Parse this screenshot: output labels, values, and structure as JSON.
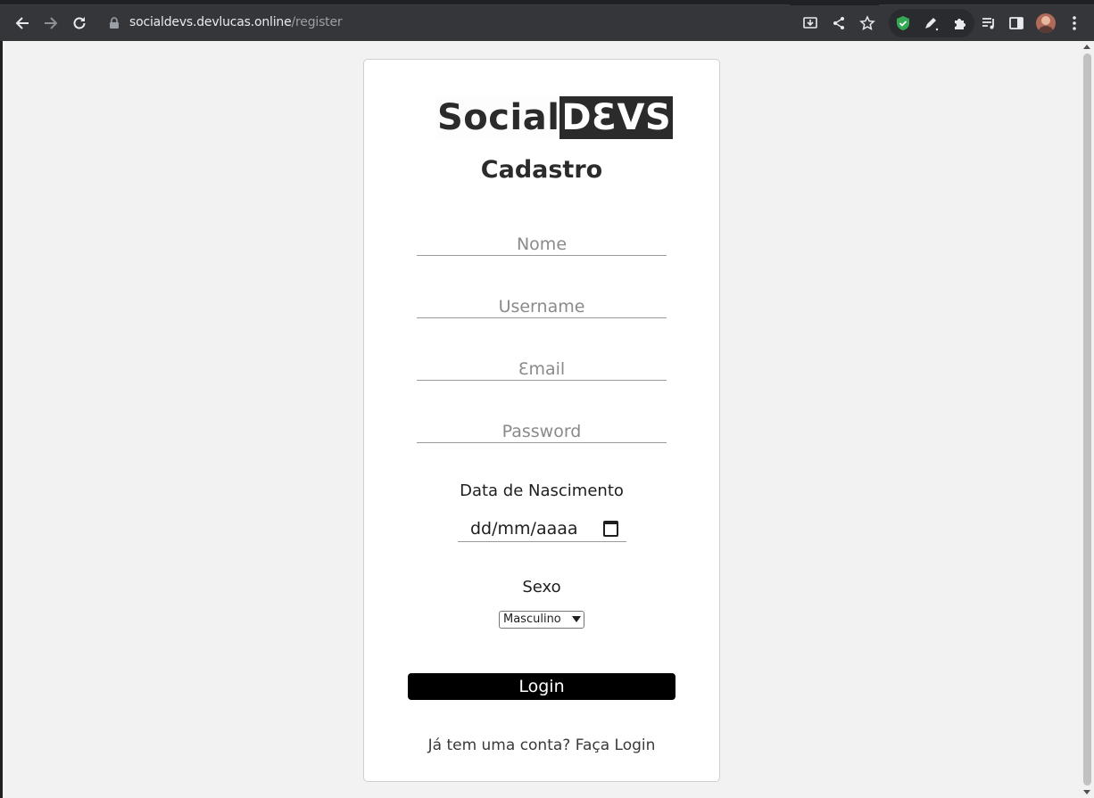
{
  "browser": {
    "url_host": "socialdevs.devlucas.online",
    "url_path": "/register"
  },
  "logo": {
    "part1": "Social",
    "part2": "DƐVS"
  },
  "form": {
    "title": "Cadastro",
    "name_placeholder": "Nome",
    "username_placeholder": "Username",
    "email_placeholder": "Ɛmail",
    "password_placeholder": "Password",
    "birth_label": "Data de Nascimento",
    "birth_value": "dd/mm/aaaa",
    "sex_label": "Sexo",
    "sex_selected": "Masculino",
    "submit_label": "Login",
    "login_link": "Já tem uma conta? Faça Login"
  },
  "icons": {
    "back": "back-arrow-icon",
    "forward": "forward-arrow-icon",
    "reload": "reload-icon",
    "lock": "lock-icon",
    "install": "install-icon",
    "share": "share-icon",
    "bookmark": "star-icon",
    "extension_shield": "shield-icon",
    "extension_pen": "pen-icon",
    "extensions": "puzzle-icon",
    "media": "media-queue-icon",
    "sidepanel": "side-panel-icon",
    "menu": "kebab-menu-icon",
    "calendar": "calendar-icon"
  }
}
